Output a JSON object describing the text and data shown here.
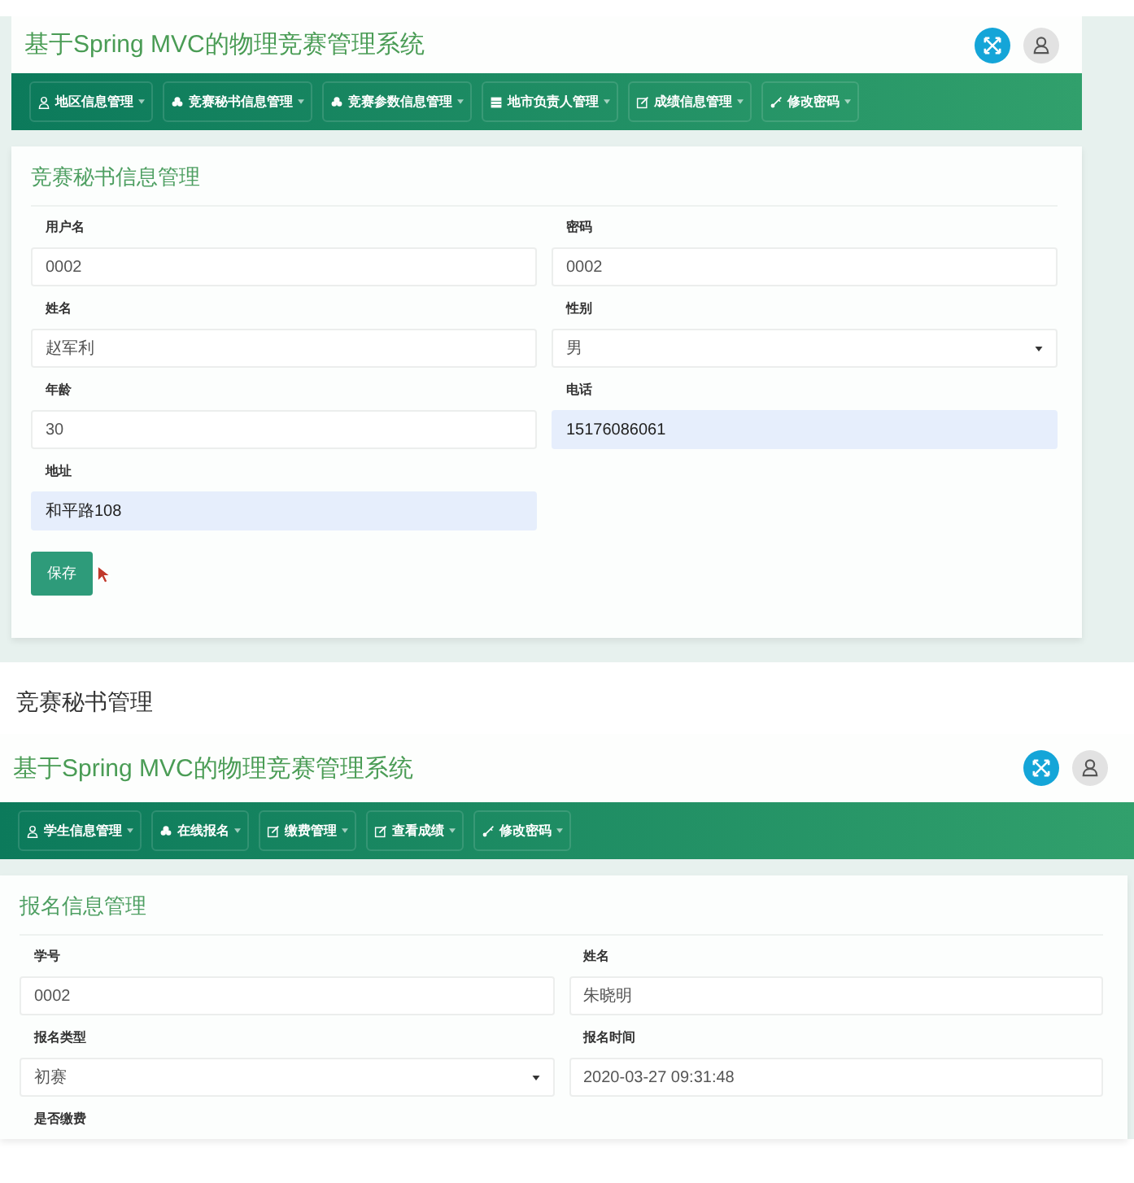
{
  "screenshots": [
    {
      "app_title": "基于Spring MVC的物理竞赛管理系统",
      "nav": [
        {
          "label": "地区信息管理",
          "kind": "user"
        },
        {
          "label": "竞赛秘书信息管理",
          "kind": "flower"
        },
        {
          "label": "竞赛参数信息管理",
          "kind": "flower"
        },
        {
          "label": "地市负责人管理",
          "kind": "table"
        },
        {
          "label": "成绩信息管理",
          "kind": "edit"
        },
        {
          "label": "修改密码",
          "kind": "key"
        }
      ],
      "card": {
        "title": "竞赛秘书信息管理",
        "fields": [
          {
            "label": "用户名",
            "value": "0002",
            "kind": "input",
            "highlighted": false
          },
          {
            "label": "密码",
            "value": "0002",
            "kind": "input",
            "highlighted": false
          },
          {
            "label": "姓名",
            "value": "赵军利",
            "kind": "input",
            "highlighted": false
          },
          {
            "label": "性别",
            "value": "男",
            "kind": "select",
            "highlighted": false
          },
          {
            "label": "年龄",
            "value": "30",
            "kind": "input",
            "highlighted": false
          },
          {
            "label": "电话",
            "value": "15176086061",
            "kind": "input",
            "highlighted": true
          },
          {
            "label": "地址",
            "value": "和平路108",
            "kind": "input",
            "highlighted": true
          }
        ],
        "button": "保存"
      }
    },
    {
      "app_title": "基于Spring MVC的物理竞赛管理系统",
      "nav": [
        {
          "label": "学生信息管理",
          "kind": "user"
        },
        {
          "label": "在线报名",
          "kind": "flower"
        },
        {
          "label": "缴费管理",
          "kind": "edit"
        },
        {
          "label": "查看成绩",
          "kind": "edit"
        },
        {
          "label": "修改密码",
          "kind": "key"
        }
      ],
      "card": {
        "title": "报名信息管理",
        "fields": [
          {
            "label": "学号",
            "value": "0002",
            "kind": "input",
            "highlighted": false
          },
          {
            "label": "姓名",
            "value": "朱晓明",
            "kind": "input",
            "highlighted": false
          },
          {
            "label": "报名类型",
            "value": "初赛",
            "kind": "select",
            "highlighted": false
          },
          {
            "label": "报名时间",
            "value": "2020-03-27 09:31:48",
            "kind": "input",
            "highlighted": false
          },
          {
            "label": "是否缴费",
            "kind": "label_only"
          }
        ]
      }
    }
  ],
  "caption": "竞赛秘书管理"
}
